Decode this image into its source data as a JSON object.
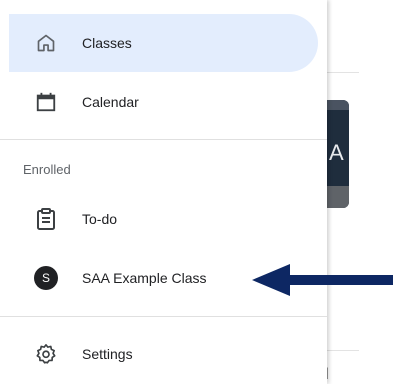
{
  "drawer": {
    "top_items": [
      {
        "label": "Classes",
        "icon": "home-icon",
        "active": true
      },
      {
        "label": "Calendar",
        "icon": "calendar-icon",
        "active": false
      }
    ],
    "section_title": "Enrolled",
    "enrolled_items": [
      {
        "label": "To-do",
        "icon": "todo-icon"
      },
      {
        "label": "SAA Example Class",
        "avatar_letter": "S"
      }
    ],
    "bottom_items": [
      {
        "label": "Settings",
        "icon": "gear-icon"
      }
    ]
  },
  "background": {
    "card_letter_fragment": "A",
    "text_fragment": "l"
  },
  "annotation": {
    "arrow_color": "#0d2763",
    "points_to": "SAA Example Class"
  },
  "colors": {
    "active_bg": "#e3edfd",
    "text": "#202124",
    "muted": "#5f6368",
    "divider": "#e0e0e0"
  }
}
